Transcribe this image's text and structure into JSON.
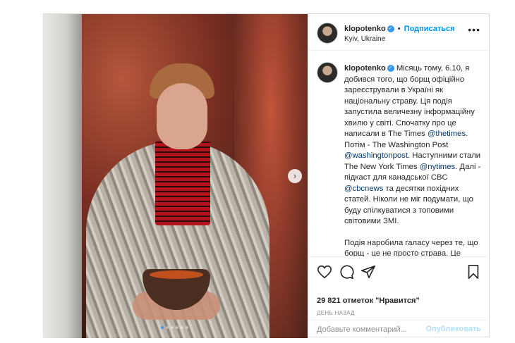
{
  "post": {
    "username": "klopotenko",
    "verified_mark": "✓",
    "separator": "•",
    "follow_label": "Подписаться",
    "location": "Kyiv, Ukraine",
    "more_label": "•••",
    "carousel": {
      "slide_count": 6,
      "active_index": 0,
      "next_icon": "chevron-right-icon",
      "next_glyph": "›"
    },
    "caption": {
      "username": "klopotenko",
      "p1_seg1": "Місяць тому, 6.10, я добився того, що борщ офіційно зареєстрували в Україні як національну страву. Ця подія запустила величезну інформаційну хвилю у світі. Спочатку про це написали в The Times ",
      "mention_thetimes": "@thetimes",
      "p1_seg2": ". Потім - The Washington Post ",
      "mention_washingtonpost": "@washingtonpost",
      "p1_seg3": ". Наступними стали The New York Times ",
      "mention_nytimes": "@nytimes",
      "p1_seg4": ". Далі - підкаст для канадської CBC ",
      "mention_cbcnews": "@cbcnews",
      "p1_seg5": " та десятки похідних статей. Ніколи не міг подумати, що буду спілкуватися з топовими світовими ЗМІ.",
      "p2": "Подія наробила галасу через те, що борщ - це не просто страва. Це частина української ідентичності та наша національна цінність."
    },
    "actions": {
      "icons": [
        "heart-icon",
        "comment-icon",
        "share-icon",
        "bookmark-icon"
      ],
      "likes_text": "29 821 отметок \"Нравится\"",
      "time_text": "ДЕНЬ НАЗАД",
      "comment_placeholder": "Добавьте комментарий...",
      "publish_label": "Опубликовать"
    },
    "colors": {
      "accent": "#0095f6",
      "verified": "#3897f0",
      "publish_disabled": "#b2dffc",
      "mention": "#00376b"
    }
  }
}
